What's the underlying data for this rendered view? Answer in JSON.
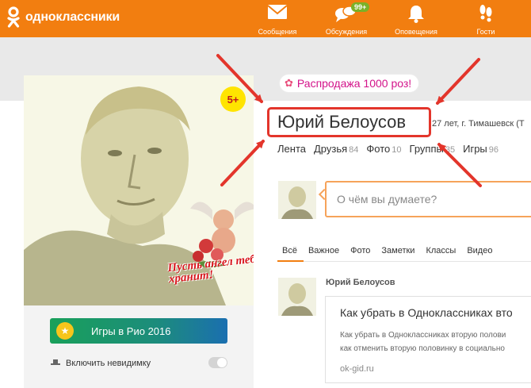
{
  "header": {
    "logo_text": "одноклассники",
    "nav": [
      {
        "label": "Сообщения",
        "icon": "envelope-icon"
      },
      {
        "label": "Обсуждения",
        "icon": "chat-bubbles-icon",
        "badge": "99+"
      },
      {
        "label": "Оповещения",
        "icon": "bell-icon"
      },
      {
        "label": "Гости",
        "icon": "footprints-icon"
      }
    ],
    "accent": "#f27e10"
  },
  "profile": {
    "age_badge": "5+",
    "angel_caption": "Пусть ангел тебя хранит!",
    "promo": "Распродажа 1000 роз!",
    "name": "Юрий Белоусов",
    "info": "27 лет, г. Тимашевск (Т",
    "tabs": [
      {
        "label": "Лента",
        "count": ""
      },
      {
        "label": "Друзья",
        "count": "84"
      },
      {
        "label": "Фото",
        "count": "10"
      },
      {
        "label": "Группы",
        "count": "35"
      },
      {
        "label": "Игры",
        "count": "96"
      }
    ]
  },
  "sidebar": {
    "games_banner": "Игры в Рио 2016",
    "invisible_label": "Включить невидимку"
  },
  "compose": {
    "placeholder": "О чём вы думаете?"
  },
  "feed": {
    "tabs": [
      "Всё",
      "Важное",
      "Фото",
      "Заметки",
      "Классы",
      "Видео"
    ],
    "active_tab": "Всё",
    "post": {
      "author": "Юрий Белоусов",
      "title": "Как убрать в Одноклассниках вто",
      "desc_line1": "Как убрать в Одноклассниках вторую полови",
      "desc_line2": "как отменить вторую половинку в социально",
      "domain": "ok-gid.ru"
    }
  },
  "colors": {
    "highlight": "#e3352b",
    "promo_text": "#d3138a"
  }
}
